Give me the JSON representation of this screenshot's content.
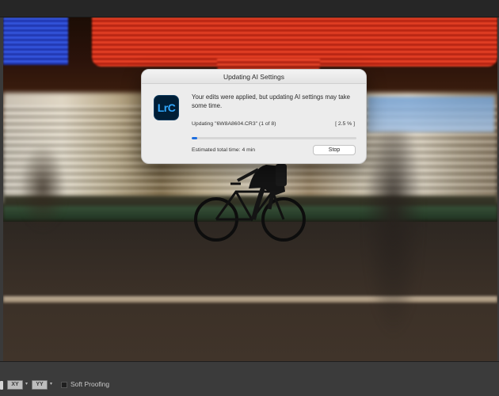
{
  "dialog": {
    "title": "Updating AI Settings",
    "app_icon_text": "LrC",
    "message": "Your edits were applied, but updating AI settings may take some time.",
    "progress_label": "Updating \"6W8A8604.CR3\" (1 of 8)",
    "progress_percent_text": "[ 2.5 % ]",
    "progress_fraction": 0.025,
    "estimate": "Estimated total time: 4 min",
    "stop_label": "Stop"
  },
  "toolbar": {
    "compare_icon_text": "XY",
    "survey_icon_text": "YY",
    "soft_proofing_label": "Soft Proofing",
    "soft_proofing_checked": false
  },
  "colors": {
    "accent": "#1e6fe0",
    "app_icon_bg": "#001e36",
    "app_icon_fg": "#31a8ff"
  },
  "icons": [
    "lightroom-classic-app-icon",
    "loupe-view-icon",
    "compare-view-icon",
    "survey-view-icon",
    "dropdown-caret-icon"
  ]
}
